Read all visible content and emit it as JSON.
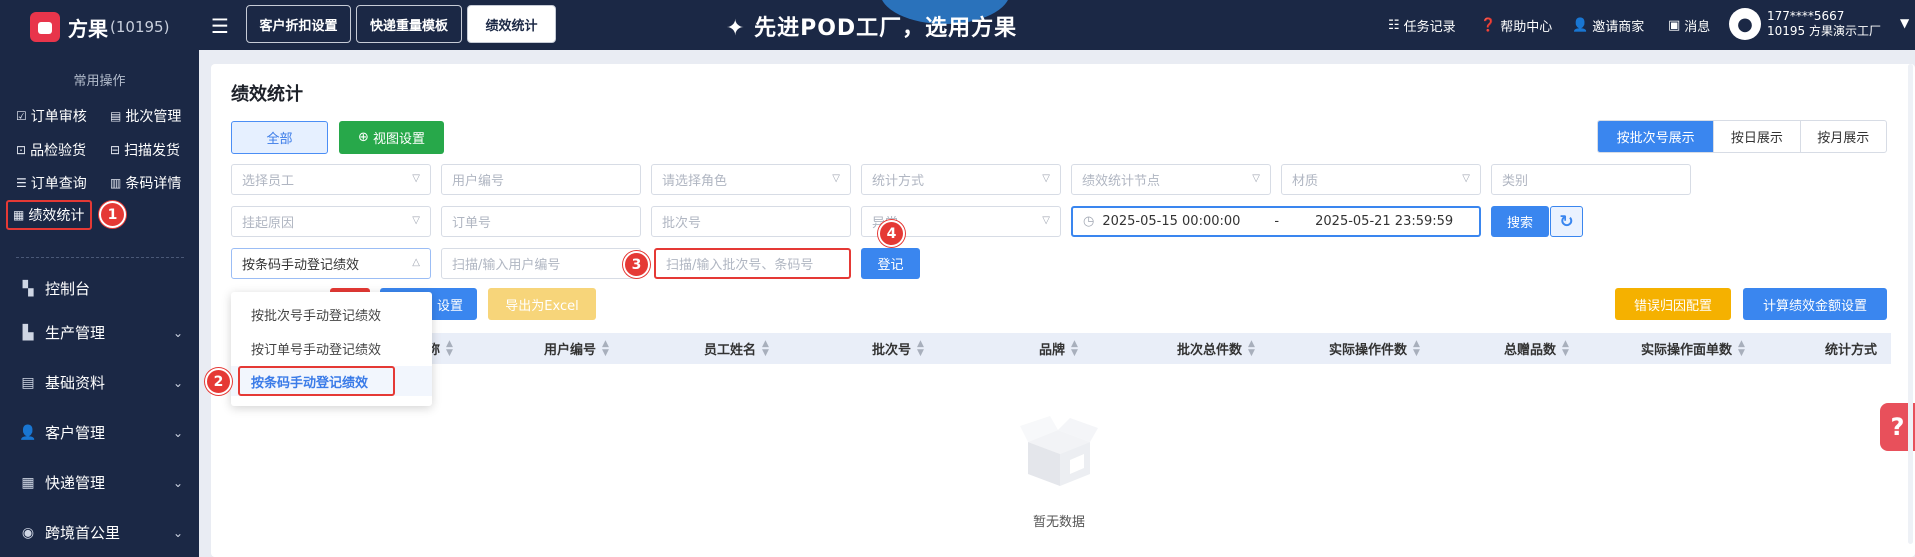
{
  "app": {
    "name": "方果",
    "count": "(10195)"
  },
  "header": {
    "tabs": [
      "客户折扣设置",
      "快递重量模板",
      "绩效统计"
    ],
    "slogan": "✦ 先进POD工厂，选用方果",
    "links": {
      "tasks": "任务记录",
      "help": "帮助中心",
      "invite": "邀请商家",
      "messages": "消息"
    },
    "user": {
      "phone": "177****5667",
      "org": "10195 方果演示工厂"
    }
  },
  "sidebar": {
    "common_title": "常用操作",
    "quick": [
      "订单审核",
      "批次管理",
      "品检验货",
      "扫描发货",
      "订单查询",
      "条码详情",
      "绩效统计"
    ],
    "groups": [
      "控制台",
      "生产管理",
      "基础资料",
      "客户管理",
      "快递管理",
      "跨境首公里"
    ]
  },
  "page": {
    "title": "绩效统计",
    "all_button": "全部",
    "view_settings": "视图设置",
    "views": [
      "按批次号展示",
      "按日展示",
      "按月展示"
    ],
    "filters_row1": [
      "选择员工",
      "用户编号",
      "请选择角色",
      "统计方式",
      "绩效统计节点",
      "材质",
      "类别"
    ],
    "filters_row2": [
      "挂起原因",
      "订单号",
      "批次号",
      "异常"
    ],
    "date_start": "2025-05-15 00:00:00",
    "date_sep": "-",
    "date_end": "2025-05-21 23:59:59",
    "search": "搜索",
    "mode_select": "按条码手动登记绩效",
    "user_scan_placeholder": "扫描/输入用户编号",
    "batch_scan_placeholder": "扫描/输入批次号、条码号",
    "register": "登记",
    "settings_partial": "设置",
    "export": "导出为Excel",
    "error_config": "错误归因配置",
    "calc_config": "计算绩效金额设置"
  },
  "table": {
    "columns": [
      "称",
      "用户编号",
      "员工姓名",
      "批次号",
      "品牌",
      "批次总件数",
      "实际操作件数",
      "总赠品数",
      "实际操作面单数",
      "统计方式"
    ],
    "empty": "暂无数据"
  },
  "dropdown": {
    "items": [
      "按批次号手动登记绩效",
      "按订单号手动登记绩效",
      "按条码手动登记绩效"
    ],
    "selected": 2
  },
  "markers": [
    "1",
    "2",
    "3",
    "4"
  ],
  "colors": {
    "nav": "#1b2845",
    "primary": "#3a86ef",
    "green": "#27a84a",
    "orange": "#f5b100",
    "annotation": "#e53935"
  }
}
